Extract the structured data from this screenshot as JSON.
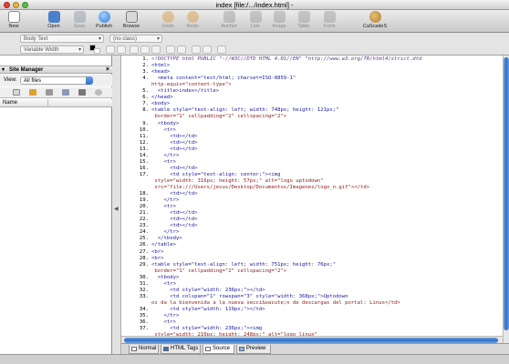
{
  "window": {
    "title": "index [file:/.../index.html] -"
  },
  "toolbar": {
    "buttons": [
      {
        "label": "New",
        "icon": "new-document-icon",
        "color": "#e8e8e8"
      },
      {
        "label": "Open",
        "icon": "open-folder-icon",
        "color": "#4a7fc9"
      },
      {
        "label": "Save",
        "icon": "save-disk-icon",
        "color": "#8a96a8"
      },
      {
        "label": "Publish",
        "icon": "publish-globe-icon",
        "color": "#2f7fd8"
      },
      {
        "label": "Browse",
        "icon": "browse-icon",
        "color": "#7a7a7a"
      },
      {
        "label": "Undo",
        "icon": "undo-arrow-icon",
        "color": "#d89a3a"
      },
      {
        "label": "Redo",
        "icon": "redo-arrow-icon",
        "color": "#d89a3a"
      },
      {
        "label": "Anchor",
        "icon": "anchor-icon",
        "color": "#999999"
      },
      {
        "label": "Link",
        "icon": "link-icon",
        "color": "#999999"
      },
      {
        "label": "Image",
        "icon": "image-icon",
        "color": "#999999"
      },
      {
        "label": "Table",
        "icon": "table-icon",
        "color": "#999999"
      },
      {
        "label": "Form",
        "icon": "form-icon",
        "color": "#999999"
      },
      {
        "label": "CaScadeS",
        "icon": "cascades-palette-icon",
        "color": "#b07a3a"
      }
    ]
  },
  "format": {
    "paragraph": "Body Text",
    "class": "(no class)",
    "font": "Variable Width"
  },
  "site_manager": {
    "title": "Site Manager",
    "view_label": "View:",
    "view_value": "All files",
    "column_name": "Name"
  },
  "editor": {
    "lines": [
      [
        "1.",
        "<!DOCTYPE html PUBLIC \"-//W3C//DTD HTML 4.01//EN\" \"http://www.w3.org/TR/html4/strict.dtd"
      ],
      [
        "2.",
        "<html>"
      ],
      [
        "3.",
        "<head>"
      ],
      [
        "4.",
        "  <meta content=\"text/html; charset=ISO-8859-1\""
      ],
      [
        "",
        "http-equiv=\"content-type\">"
      ],
      [
        "5.",
        "  <title>index</title>"
      ],
      [
        "6.",
        "</head>"
      ],
      [
        "7.",
        "<body>"
      ],
      [
        "8.",
        "<table style=\"text-align: left; width: 748px; height: 121px;\""
      ],
      [
        "",
        " border=\"1\" cellpadding=\"2\" cellspacing=\"2\">"
      ],
      [
        "9.",
        "  <tbody>"
      ],
      [
        "10.",
        "    <tr>"
      ],
      [
        "11.",
        "      <td></td>"
      ],
      [
        "12.",
        "      <td></td>"
      ],
      [
        "13.",
        "      <td></td>"
      ],
      [
        "14.",
        "    </tr>"
      ],
      [
        "15.",
        "    <tr>"
      ],
      [
        "16.",
        "      <td></td>"
      ],
      [
        "17.",
        "      <td style=\"text-align: center;\"><img"
      ],
      [
        "",
        " style=\"width: 316px; height: 57px;\" alt=\"logo uptodown\""
      ],
      [
        "",
        " src=\"file:///Users/jesus/Desktop/Documentos/Imagenes/logo_n.gif\"></td>"
      ],
      [
        "18.",
        "      <td></td>"
      ],
      [
        "19.",
        "    </tr>"
      ],
      [
        "20.",
        "    <tr>"
      ],
      [
        "21.",
        "      <td></td>"
      ],
      [
        "22.",
        "      <td></td>"
      ],
      [
        "23.",
        "      <td></td>"
      ],
      [
        "24.",
        "    </tr>"
      ],
      [
        "25.",
        "  </tbody>"
      ],
      [
        "26.",
        "</table>"
      ],
      [
        "27.",
        "<br>"
      ],
      [
        "28.",
        "<br>"
      ],
      [
        "29.",
        "<table style=\"text-align: left; width: 751px; height: 76px;\""
      ],
      [
        "",
        " border=\"1\" cellpadding=\"2\" cellspacing=\"2\">"
      ],
      [
        "30.",
        "  <tbody>"
      ],
      [
        "31.",
        "    <tr>"
      ],
      [
        "32.",
        "      <td style=\"width: 236px;\"></td>"
      ],
      [
        "33.",
        "      <td colspan=\"1\" rowspan=\"3\" style=\"width: 368px;\">Uptodown"
      ],
      [
        "",
        "os da la bienvenida a la nueva secci&oacute;n de descargas del portal: Linux</td>"
      ],
      [
        "34.",
        "      <td style=\"width: 119px;\"></td>"
      ],
      [
        "35.",
        "    </tr>"
      ],
      [
        "36.",
        "    <tr>"
      ],
      [
        "37.",
        "      <td style=\"width: 236px;\"><img"
      ],
      [
        "",
        " style=\"width: 210px; height: 248px;\" alt=\"logo linux\""
      ],
      [
        "",
        " src=\"file:///Users/jesus/Desktop/linux.jpg\"></td>"
      ]
    ]
  },
  "tabs": [
    {
      "label": "Normal",
      "active": false
    },
    {
      "label": "HTML Tags",
      "active": false
    },
    {
      "label": "Source",
      "active": true
    },
    {
      "label": "Preview",
      "active": false
    }
  ],
  "colors": {
    "tag_blue": "#1a1a9a",
    "attr_red": "#8a1a1a",
    "doctype": "#5a3a8a",
    "scroll_blue": "#2f6fc8"
  }
}
